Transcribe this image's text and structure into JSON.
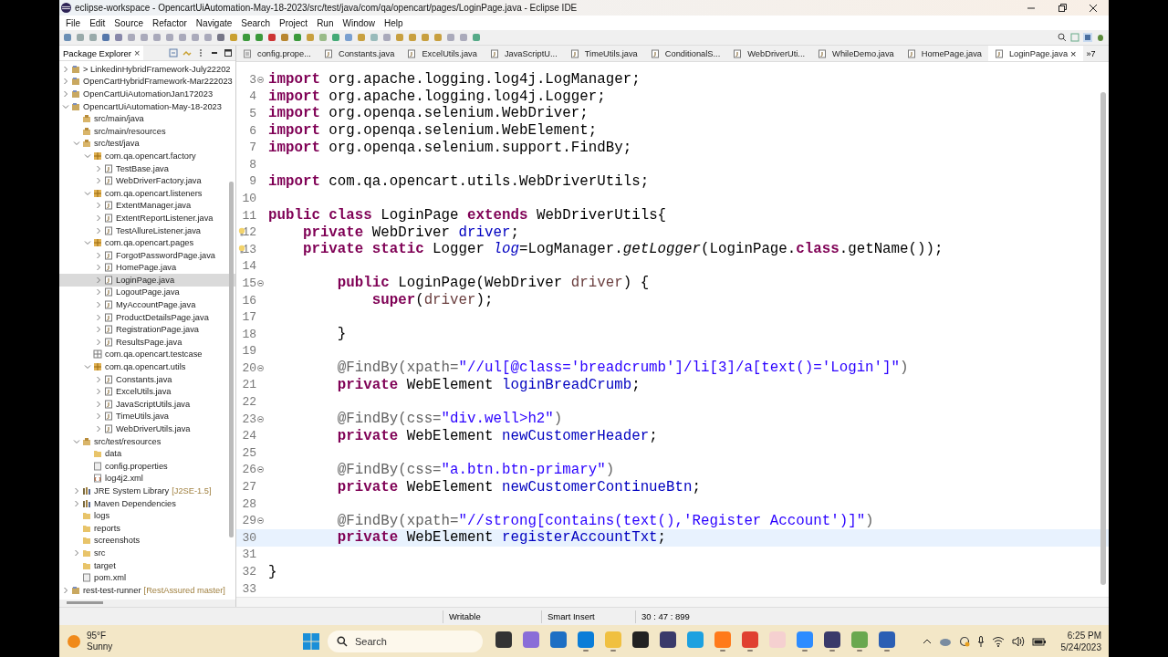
{
  "window": {
    "title": "eclipse-workspace - OpencartUiAutomation-May-18-2023/src/test/java/com/qa/opencart/pages/LoginPage.java - Eclipse IDE"
  },
  "menu": [
    "File",
    "Edit",
    "Source",
    "Refactor",
    "Navigate",
    "Search",
    "Project",
    "Run",
    "Window",
    "Help"
  ],
  "package_explorer": {
    "title": "Package Explorer",
    "close": "×",
    "items": [
      {
        "label": "> LinkedinHybridFramework-July22202",
        "kind": "project",
        "expanded": false,
        "selected": false
      },
      {
        "label": "OpenCartHybridFramework-Mar222023",
        "kind": "project",
        "expanded": false,
        "selected": false
      },
      {
        "label": "OpenCartUiAutomationJan172023",
        "kind": "project",
        "expanded": false,
        "selected": false
      },
      {
        "label": "OpencartUiAutomation-May-18-2023",
        "kind": "project",
        "expanded": true,
        "selected": false,
        "children": [
          {
            "label": "src/main/java",
            "kind": "source",
            "selected": false
          },
          {
            "label": "src/main/resources",
            "kind": "source",
            "selected": false
          },
          {
            "label": "src/test/java",
            "kind": "source",
            "expanded": true,
            "selected": false,
            "children": [
              {
                "label": "com.qa.opencart.factory",
                "kind": "package",
                "expanded": true,
                "selected": false,
                "children": [
                  {
                    "label": "TestBase.java",
                    "kind": "java",
                    "expanded": false,
                    "selected": false
                  },
                  {
                    "label": "WebDriverFactory.java",
                    "kind": "java",
                    "expanded": false,
                    "selected": false
                  }
                ]
              },
              {
                "label": "com.qa.opencart.listeners",
                "kind": "package",
                "expanded": true,
                "selected": false,
                "children": [
                  {
                    "label": "ExtentManager.java",
                    "kind": "java",
                    "expanded": false,
                    "selected": false
                  },
                  {
                    "label": "ExtentReportListener.java",
                    "kind": "java",
                    "expanded": false,
                    "selected": false
                  },
                  {
                    "label": "TestAllureListener.java",
                    "kind": "java",
                    "expanded": false,
                    "selected": false
                  }
                ]
              },
              {
                "label": "com.qa.opencart.pages",
                "kind": "package",
                "expanded": true,
                "selected": false,
                "children": [
                  {
                    "label": "ForgotPasswordPage.java",
                    "kind": "java",
                    "expanded": false,
                    "selected": false
                  },
                  {
                    "label": "HomePage.java",
                    "kind": "java",
                    "expanded": false,
                    "selected": false
                  },
                  {
                    "label": "LoginPage.java",
                    "kind": "java",
                    "expanded": false,
                    "selected": true
                  },
                  {
                    "label": "LogoutPage.java",
                    "kind": "java",
                    "expanded": false,
                    "selected": false
                  },
                  {
                    "label": "MyAccountPage.java",
                    "kind": "java",
                    "expanded": false,
                    "selected": false
                  },
                  {
                    "label": "ProductDetailsPage.java",
                    "kind": "java",
                    "expanded": false,
                    "selected": false
                  },
                  {
                    "label": "RegistrationPage.java",
                    "kind": "java",
                    "expanded": false,
                    "selected": false
                  },
                  {
                    "label": "ResultsPage.java",
                    "kind": "java",
                    "expanded": false,
                    "selected": false
                  }
                ]
              },
              {
                "label": "com.qa.opencart.testcase",
                "kind": "empty-package",
                "selected": false
              },
              {
                "label": "com.qa.opencart.utils",
                "kind": "package",
                "expanded": true,
                "selected": false,
                "children": [
                  {
                    "label": "Constants.java",
                    "kind": "java",
                    "expanded": false,
                    "selected": false
                  },
                  {
                    "label": "ExcelUtils.java",
                    "kind": "java",
                    "expanded": false,
                    "selected": false
                  },
                  {
                    "label": "JavaScriptUtils.java",
                    "kind": "java",
                    "expanded": false,
                    "selected": false
                  },
                  {
                    "label": "TimeUtils.java",
                    "kind": "java",
                    "expanded": false,
                    "selected": false
                  },
                  {
                    "label": "WebDriverUtils.java",
                    "kind": "java",
                    "expanded": false,
                    "selected": false
                  }
                ]
              }
            ]
          },
          {
            "label": "src/test/resources",
            "kind": "source",
            "expanded": true,
            "selected": false,
            "children": [
              {
                "label": "data",
                "kind": "folder",
                "selected": false
              },
              {
                "label": "config.properties",
                "kind": "file",
                "selected": false
              },
              {
                "label": "log4j2.xml",
                "kind": "xml",
                "selected": false
              }
            ]
          },
          {
            "label": "JRE System Library",
            "decoration": "[J2SE-1.5]",
            "kind": "library",
            "expanded": false,
            "selected": false
          },
          {
            "label": "Maven Dependencies",
            "kind": "library",
            "expanded": false,
            "selected": false
          },
          {
            "label": "logs",
            "kind": "folder",
            "selected": false
          },
          {
            "label": "reports",
            "kind": "folder",
            "selected": false
          },
          {
            "label": "screenshots",
            "kind": "folder",
            "selected": false
          },
          {
            "label": "src",
            "kind": "folder",
            "expanded": false,
            "selected": false
          },
          {
            "label": "target",
            "kind": "folder",
            "selected": false
          },
          {
            "label": "pom.xml",
            "kind": "file",
            "selected": false
          }
        ]
      },
      {
        "label": "rest-test-runner",
        "decoration": "[RestAssured master]",
        "kind": "project",
        "expanded": false,
        "selected": false
      }
    ]
  },
  "editor_tabs": [
    {
      "label": "config.prope...",
      "kind": "properties",
      "selected": false
    },
    {
      "label": "Constants.java",
      "kind": "java",
      "selected": false
    },
    {
      "label": "ExcelUtils.java",
      "kind": "java",
      "selected": false
    },
    {
      "label": "JavaScriptU...",
      "kind": "java",
      "selected": false
    },
    {
      "label": "TimeUtils.java",
      "kind": "java",
      "selected": false
    },
    {
      "label": "ConditionalS...",
      "kind": "java",
      "selected": false
    },
    {
      "label": "WebDriverUti...",
      "kind": "java",
      "selected": false
    },
    {
      "label": "WhileDemo.java",
      "kind": "java",
      "selected": false
    },
    {
      "label": "HomePage.java",
      "kind": "java",
      "selected": false
    },
    {
      "label": "LoginPage.java",
      "kind": "java",
      "selected": true,
      "close": "×"
    }
  ],
  "editor_overflow": "»7",
  "code_lines": [
    {
      "number": "3",
      "fold": true,
      "selected": false,
      "segments": [
        {
          "kind": "keyword",
          "text": "import"
        },
        {
          "kind": "plain",
          "text": " org.apache.logging.log4j.LogManager;"
        }
      ]
    },
    {
      "number": "4",
      "selected": false,
      "segments": [
        {
          "kind": "keyword",
          "text": "import"
        },
        {
          "kind": "plain",
          "text": " org.apache.logging.log4j.Logger;"
        }
      ]
    },
    {
      "number": "5",
      "selected": false,
      "segments": [
        {
          "kind": "keyword",
          "text": "import"
        },
        {
          "kind": "plain",
          "text": " org.openqa.selenium.WebDriver;"
        }
      ]
    },
    {
      "number": "6",
      "selected": false,
      "segments": [
        {
          "kind": "keyword",
          "text": "import"
        },
        {
          "kind": "plain",
          "text": " org.openqa.selenium.WebElement;"
        }
      ]
    },
    {
      "number": "7",
      "selected": false,
      "segments": [
        {
          "kind": "keyword",
          "text": "import"
        },
        {
          "kind": "plain",
          "text": " org.openqa.selenium.support.FindBy;"
        }
      ]
    },
    {
      "number": "8",
      "selected": false
    },
    {
      "number": "9",
      "selected": false,
      "segments": [
        {
          "kind": "keyword",
          "text": "import"
        },
        {
          "kind": "plain",
          "text": " com.qa.opencart.utils.WebDriverUtils;"
        }
      ]
    },
    {
      "number": "10",
      "selected": false
    },
    {
      "number": "11",
      "selected": false,
      "segments": [
        {
          "kind": "keyword",
          "text": "public"
        },
        {
          "kind": "keyword",
          "text": " class"
        },
        {
          "kind": "plain",
          "text": " LoginPage "
        },
        {
          "kind": "keyword",
          "text": "extends"
        },
        {
          "kind": "plain",
          "text": " WebDriverUtils{"
        }
      ]
    },
    {
      "number": "12",
      "warning": true,
      "selected": false,
      "segments": [
        {
          "kind": "keyword",
          "text": "    private"
        },
        {
          "kind": "plain",
          "text": " WebDriver "
        },
        {
          "kind": "field",
          "text": "driver"
        },
        {
          "kind": "plain",
          "text": ";"
        }
      ]
    },
    {
      "number": "13",
      "warning": true,
      "selected": false,
      "segments": [
        {
          "kind": "keyword",
          "text": "    private"
        },
        {
          "kind": "keyword",
          "text": " static"
        },
        {
          "kind": "plain",
          "text": " Logger "
        },
        {
          "kind": "static-field",
          "text": "log"
        },
        {
          "kind": "plain",
          "text": "=LogManager."
        },
        {
          "kind": "static-method",
          "text": "getLogger"
        },
        {
          "kind": "plain",
          "text": "(LoginPage."
        },
        {
          "kind": "keyword",
          "text": "class"
        },
        {
          "kind": "plain",
          "text": ".getName());"
        }
      ]
    },
    {
      "number": "14",
      "selected": false
    },
    {
      "number": "15",
      "fold": true,
      "selected": false,
      "segments": [
        {
          "kind": "keyword",
          "text": "        public"
        },
        {
          "kind": "plain",
          "text": " LoginPage(WebDriver "
        },
        {
          "kind": "param",
          "text": "driver"
        },
        {
          "kind": "plain",
          "text": ") {"
        }
      ]
    },
    {
      "number": "16",
      "selected": false,
      "segments": [
        {
          "kind": "keyword",
          "text": "            super"
        },
        {
          "kind": "plain",
          "text": "("
        },
        {
          "kind": "param",
          "text": "driver"
        },
        {
          "kind": "plain",
          "text": ");"
        }
      ]
    },
    {
      "number": "17",
      "selected": false
    },
    {
      "number": "18",
      "selected": false,
      "segments": [
        {
          "kind": "plain",
          "text": "        }"
        }
      ]
    },
    {
      "number": "19",
      "selected": false
    },
    {
      "number": "20",
      "fold": true,
      "selected": false,
      "segments": [
        {
          "kind": "annotation",
          "text": "        @FindBy(xpath="
        },
        {
          "kind": "string",
          "text": "\"//ul[@class='breadcrumb']/li[3]/a[text()='Login']\""
        },
        {
          "kind": "annotation",
          "text": ")"
        }
      ]
    },
    {
      "number": "21",
      "selected": false,
      "segments": [
        {
          "kind": "keyword",
          "text": "        private"
        },
        {
          "kind": "plain",
          "text": " WebElement "
        },
        {
          "kind": "field",
          "text": "loginBreadCrumb"
        },
        {
          "kind": "plain",
          "text": ";"
        }
      ]
    },
    {
      "number": "22",
      "selected": false
    },
    {
      "number": "23",
      "fold": true,
      "selected": false,
      "segments": [
        {
          "kind": "annotation",
          "text": "        @FindBy(css="
        },
        {
          "kind": "string",
          "text": "\"div.well>h2\""
        },
        {
          "kind": "annotation",
          "text": ")"
        }
      ]
    },
    {
      "number": "24",
      "selected": false,
      "segments": [
        {
          "kind": "keyword",
          "text": "        private"
        },
        {
          "kind": "plain",
          "text": " WebElement "
        },
        {
          "kind": "field",
          "text": "newCustomerHeader"
        },
        {
          "kind": "plain",
          "text": ";"
        }
      ]
    },
    {
      "number": "25",
      "selected": false
    },
    {
      "number": "26",
      "fold": true,
      "selected": false,
      "segments": [
        {
          "kind": "annotation",
          "text": "        @FindBy(css="
        },
        {
          "kind": "string",
          "text": "\"a.btn.btn-primary\""
        },
        {
          "kind": "annotation",
          "text": ")"
        }
      ]
    },
    {
      "number": "27",
      "selected": false,
      "segments": [
        {
          "kind": "keyword",
          "text": "        private"
        },
        {
          "kind": "plain",
          "text": " WebElement "
        },
        {
          "kind": "field",
          "text": "newCustomerContinueBtn"
        },
        {
          "kind": "plain",
          "text": ";"
        }
      ]
    },
    {
      "number": "28",
      "selected": false
    },
    {
      "number": "29",
      "fold": true,
      "selected": false,
      "segments": [
        {
          "kind": "annotation",
          "text": "        @FindBy(xpath="
        },
        {
          "kind": "string",
          "text": "\"//strong[contains(text(),'Register Account')]\""
        },
        {
          "kind": "annotation",
          "text": ")"
        }
      ]
    },
    {
      "number": "30",
      "selected": true,
      "segments": [
        {
          "kind": "keyword",
          "text": "        private"
        },
        {
          "kind": "plain",
          "text": " WebElement "
        },
        {
          "kind": "field",
          "text": "registerAccountTxt"
        },
        {
          "kind": "plain",
          "text": ";"
        }
      ]
    },
    {
      "number": "31",
      "selected": false
    },
    {
      "number": "32",
      "selected": false,
      "segments": [
        {
          "kind": "plain",
          "text": "}"
        }
      ]
    },
    {
      "number": "33",
      "selected": false
    }
  ],
  "status_bar": [
    "Writable",
    "Smart Insert",
    "30 : 47 : 899"
  ],
  "taskbar": {
    "weather": {
      "temperature": "95°F",
      "condition": "Sunny"
    },
    "search": {
      "placeholder": "Search"
    },
    "apps": [
      {
        "running": false
      },
      {
        "running": false
      },
      {
        "running": false
      },
      {
        "running": true
      },
      {
        "running": true
      },
      {
        "running": false
      },
      {
        "running": false
      },
      {
        "running": false
      },
      {
        "running": true
      },
      {
        "running": true
      },
      {
        "running": false
      },
      {
        "running": true
      },
      {
        "running": true
      },
      {
        "running": true
      },
      {
        "running": true
      }
    ],
    "time": "6:25 PM",
    "date": "5/24/2023"
  }
}
